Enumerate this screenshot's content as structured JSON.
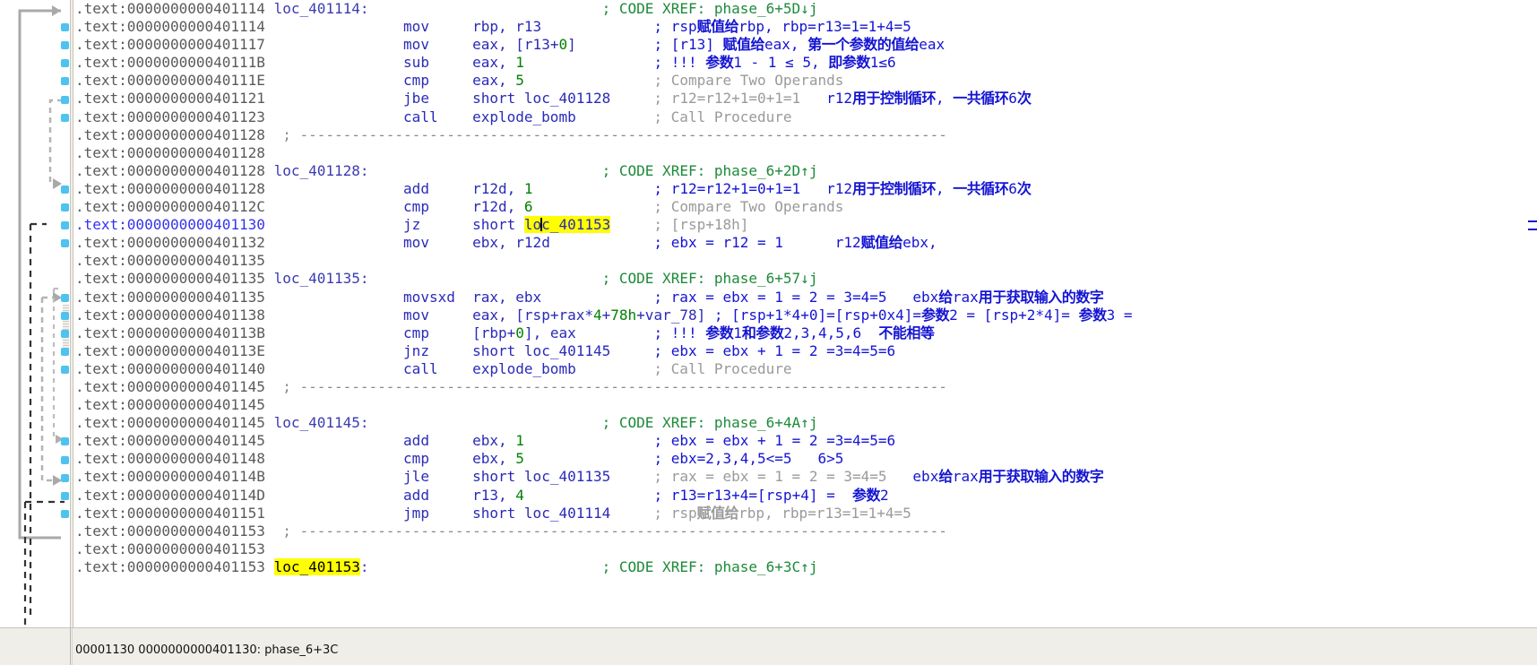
{
  "window": {
    "title": "IDA View-A",
    "segment": "text"
  },
  "statusbar": {
    "text": "00001130 0000000000401130: phase_6+3C"
  },
  "highlight": {
    "token": "loc_401153",
    "color": "#ffff00"
  },
  "colors": {
    "address": "#5a5a5a",
    "current_address": "#3333ee",
    "mnemonic": "#2a2ab8",
    "number": "#008000",
    "auto_comment": "#9a9a9a",
    "xref_comment": "#1d8a3a",
    "user_comment": "#1414d2",
    "highlight_bg": "#ffff00",
    "gutter_arrow": "#a0a0a0",
    "line_dot": "#4ec3f0"
  },
  "lines": [
    {
      "addr": ".text:0000000000401114",
      "label": "loc_401114:",
      "cmt": "; CODE XREF: phase_6+5D↓j",
      "cmt_kind": "xref",
      "dot": false
    },
    {
      "addr": ".text:0000000000401114",
      "mnem": "mov",
      "ops": "rbp, r13",
      "cmt": "; rsp赋值给rbp, rbp=r13=1=1+4=5",
      "cmt_kind": "user",
      "dot": true
    },
    {
      "addr": ".text:0000000000401117",
      "mnem": "mov",
      "ops": "eax, [r13+0]",
      "cmt": "; [r13] 赋值给eax, 第一个参数的值给eax",
      "cmt_kind": "user",
      "dot": true
    },
    {
      "addr": ".text:000000000040111B",
      "mnem": "sub",
      "ops": "eax, 1",
      "cmt": "; !!! 参数1 - 1 ≤ 5, 即参数1≤6",
      "cmt_kind": "user",
      "dot": true
    },
    {
      "addr": ".text:000000000040111E",
      "mnem": "cmp",
      "ops": "eax, 5",
      "cmt": "; Compare Two Operands",
      "cmt_kind": "auto",
      "dot": true
    },
    {
      "addr": ".text:0000000000401121",
      "mnem": "jbe",
      "ops": "short loc_401128",
      "cmt": "; r12=r12+1=0+1=1   r12用于控制循环, 一共循环6次",
      "cmt_kind": "auto-mixed",
      "dot": true
    },
    {
      "addr": ".text:0000000000401123",
      "mnem": "call",
      "ops": "explode_bomb",
      "cmt": "; Call Procedure",
      "cmt_kind": "auto",
      "dot": true
    },
    {
      "addr": ".text:0000000000401128",
      "sep": true,
      "dot": false
    },
    {
      "addr": ".text:0000000000401128",
      "dot": false
    },
    {
      "addr": ".text:0000000000401128",
      "label": "loc_401128:",
      "cmt": "; CODE XREF: phase_6+2D↑j",
      "cmt_kind": "xref",
      "dot": false
    },
    {
      "addr": ".text:0000000000401128",
      "mnem": "add",
      "ops": "r12d, 1",
      "cmt": "; r12=r12+1=0+1=1   r12用于控制循环, 一共循环6次",
      "cmt_kind": "user",
      "dot": true
    },
    {
      "addr": ".text:000000000040112C",
      "mnem": "cmp",
      "ops": "r12d, 6",
      "cmt": "; Compare Two Operands",
      "cmt_kind": "auto",
      "dot": true
    },
    {
      "addr": ".text:0000000000401130",
      "mnem": "jz",
      "ops": "short loc_401153",
      "cmt": "; [rsp+18h]",
      "cmt_kind": "auto",
      "dot": true,
      "current": true,
      "hl_op": true
    },
    {
      "addr": ".text:0000000000401132",
      "mnem": "mov",
      "ops": "ebx, r12d",
      "cmt": "; ebx = r12 = 1      r12赋值给ebx,",
      "cmt_kind": "user",
      "dot": true
    },
    {
      "addr": ".text:0000000000401135",
      "dot": false
    },
    {
      "addr": ".text:0000000000401135",
      "label": "loc_401135:",
      "cmt": "; CODE XREF: phase_6+57↓j",
      "cmt_kind": "xref",
      "dot": false
    },
    {
      "addr": ".text:0000000000401135",
      "mnem": "movsxd",
      "ops": "rax, ebx",
      "cmt": "; rax = ebx = 1 = 2 = 3=4=5   ebx给rax用于获取输入的数字",
      "cmt_kind": "user",
      "dot": true
    },
    {
      "addr": ".text:0000000000401138",
      "mnem": "mov",
      "ops": "eax, [rsp+rax*4+78h+var_78]",
      "cmt": "; [rsp+1*4+0]=[rsp+0x4]=参数2 = [rsp+2*4]= 参数3 =",
      "cmt_kind": "user",
      "dot": true
    },
    {
      "addr": ".text:000000000040113B",
      "mnem": "cmp",
      "ops": "[rbp+0], eax",
      "cmt": "; !!! 参数1和参数2,3,4,5,6  不能相等",
      "cmt_kind": "user",
      "dot": true
    },
    {
      "addr": ".text:000000000040113E",
      "mnem": "jnz",
      "ops": "short loc_401145",
      "cmt": "; ebx = ebx + 1 = 2 =3=4=5=6",
      "cmt_kind": "user",
      "dot": true
    },
    {
      "addr": ".text:0000000000401140",
      "mnem": "call",
      "ops": "explode_bomb",
      "cmt": "; Call Procedure",
      "cmt_kind": "auto",
      "dot": true
    },
    {
      "addr": ".text:0000000000401145",
      "sep": true,
      "dot": false
    },
    {
      "addr": ".text:0000000000401145",
      "dot": false
    },
    {
      "addr": ".text:0000000000401145",
      "label": "loc_401145:",
      "cmt": "; CODE XREF: phase_6+4A↑j",
      "cmt_kind": "xref",
      "dot": false
    },
    {
      "addr": ".text:0000000000401145",
      "mnem": "add",
      "ops": "ebx, 1",
      "cmt": "; ebx = ebx + 1 = 2 =3=4=5=6",
      "cmt_kind": "user",
      "dot": true
    },
    {
      "addr": ".text:0000000000401148",
      "mnem": "cmp",
      "ops": "ebx, 5",
      "cmt": "; ebx=2,3,4,5<=5   6>5",
      "cmt_kind": "user",
      "dot": true
    },
    {
      "addr": ".text:000000000040114B",
      "mnem": "jle",
      "ops": "short loc_401135",
      "cmt": "; rax = ebx = 1 = 2 = 3=4=5   ebx给rax用于获取输入的数字",
      "cmt_kind": "auto-mixed",
      "dot": true
    },
    {
      "addr": ".text:000000000040114D",
      "mnem": "add",
      "ops": "r13, 4",
      "cmt": "; r13=r13+4=[rsp+4] =  参数2",
      "cmt_kind": "user",
      "dot": true
    },
    {
      "addr": ".text:0000000000401151",
      "mnem": "jmp",
      "ops": "short loc_401114",
      "cmt": "; rsp赋值给rbp, rbp=r13=1=1+4=5",
      "cmt_kind": "auto-mixed",
      "dot": true
    },
    {
      "addr": ".text:0000000000401153",
      "sep": true,
      "dot": false
    },
    {
      "addr": ".text:0000000000401153",
      "dot": false
    },
    {
      "addr": ".text:0000000000401153",
      "label": "loc_401153:",
      "label_hl": true,
      "cmt": "; CODE XREF: phase_6+3C↑j",
      "cmt_kind": "xref",
      "dot": false
    }
  ],
  "separator_dashes": "; ---------------------------------------------------------------------------"
}
